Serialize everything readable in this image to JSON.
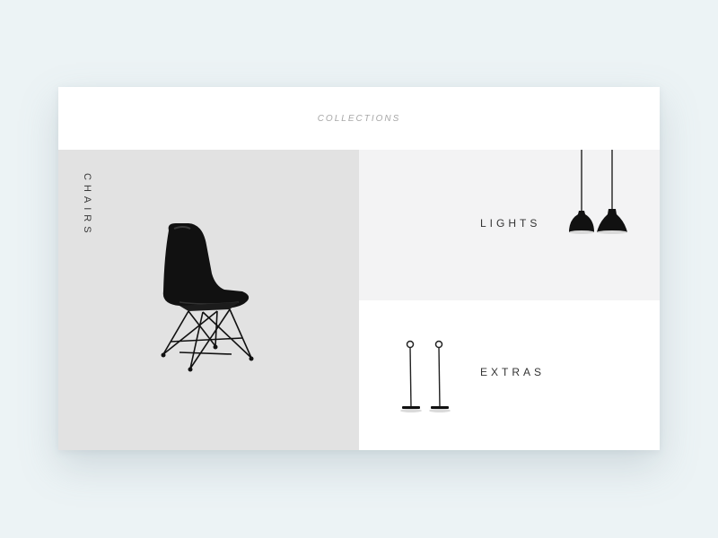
{
  "header": {
    "title": "COLLECTIONS"
  },
  "tiles": [
    {
      "label": "CHAIRS",
      "icon": "chair-icon"
    },
    {
      "label": "LIGHTS",
      "icon": "pendant-lamp-icon"
    },
    {
      "label": "EXTRAS",
      "icon": "stand-icon"
    }
  ],
  "colors": {
    "background": "#ecf3f5",
    "card": "#ffffff",
    "chairs_tile": "#e2e2e2",
    "lights_tile": "#f3f3f4",
    "extras_tile": "#ffffff",
    "text": "#333333",
    "muted_text": "#a7a7a7"
  }
}
